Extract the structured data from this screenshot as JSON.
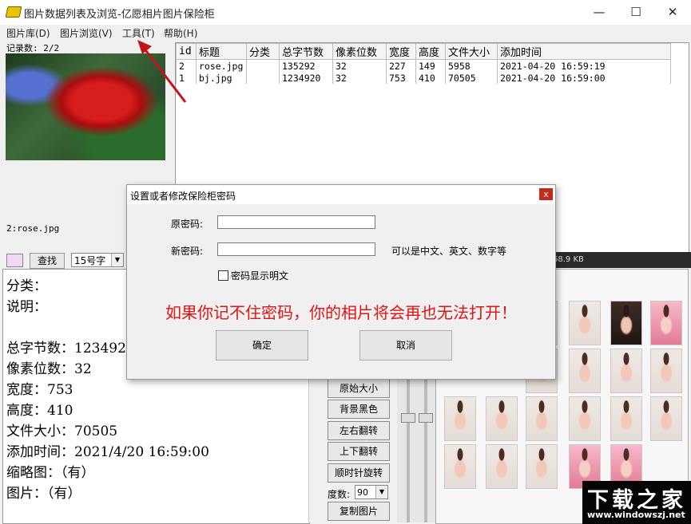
{
  "window": {
    "title": "图片数据列表及浏览-亿愿相片图片保险柜",
    "minimize": "—",
    "maximize": "☐",
    "close": "✕"
  },
  "menu": [
    "图片库(D)",
    "图片浏览(V)",
    "工具(T)",
    "帮助(H)"
  ],
  "record_count": "记录数: 2/2",
  "preview_caption": "2:rose.jpg",
  "table": {
    "headers": [
      "id",
      "标题",
      "分类",
      "总字节数",
      "像素位数",
      "宽度",
      "高度",
      "文件大小",
      "添加时间"
    ],
    "rows": [
      [
        "2",
        "rose.jpg",
        "",
        "135292",
        "32",
        "227",
        "149",
        "5958",
        "2021-04-20 16:59:19"
      ],
      [
        "1",
        "bj.jpg",
        "",
        "1234920",
        "32",
        "753",
        "410",
        "70505",
        "2021-04-20 16:59:00"
      ]
    ]
  },
  "toolbar": {
    "find_label": "查找",
    "font_size": "15号字",
    "size_readout": "68.9 KB"
  },
  "details": [
    "分类：",
    "说明：",
    "",
    "总字节数：123492",
    "像素位数：32",
    "宽度：753",
    "高度：410",
    "文件大小：70505",
    "添加时间：2021/4/20 16:59:00",
    "缩略图：（有）",
    "图片：（有）"
  ],
  "tools": {
    "original_size": "原始大小",
    "black_bg": "背景黑色",
    "flip_h": "左右翻转",
    "flip_v": "上下翻转",
    "rotate_cw": "顺时针旋转",
    "angle_label": "度数:",
    "angle_value": "90",
    "copy_image": "复制图片"
  },
  "dialog": {
    "title": "设置或者修改保险柜密码",
    "close": "x",
    "old_password_label": "原密码:",
    "new_password_label": "新密码:",
    "new_password_hint": "可以是中文、英文、数字等",
    "show_password_label": "密码显示明文",
    "warning": "如果你记不住密码，你的相片将会再也无法打开！",
    "ok": "确定",
    "cancel": "取消"
  },
  "watermark": {
    "main": "下载之家",
    "url": "www.windowszj.net"
  },
  "colors": {
    "warning": "#e01414",
    "close_red": "#c42b1c",
    "annotation_arrow": "#c0161b",
    "swatch": "#f0d8f6"
  },
  "icons": [
    "app-icon",
    "arrow-annotation"
  ]
}
